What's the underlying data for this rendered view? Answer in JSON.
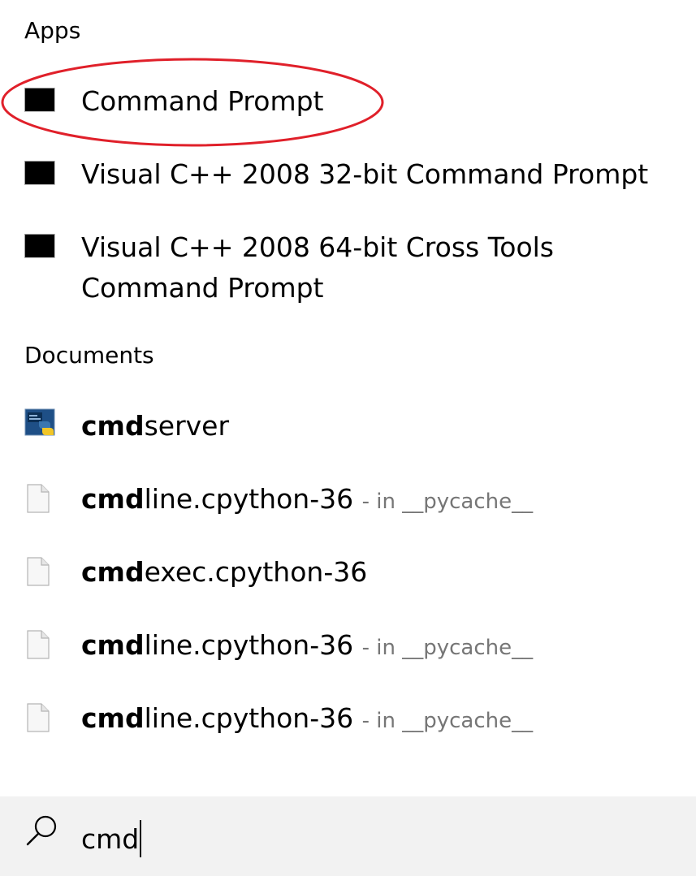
{
  "sections": {
    "apps_header": "Apps",
    "documents_header": "Documents"
  },
  "apps": [
    {
      "label": "Command Prompt",
      "icon": "command-prompt-icon"
    },
    {
      "label": "Visual C++ 2008 32-bit Command Prompt",
      "icon": "command-prompt-icon"
    },
    {
      "label_line1": "Visual C++ 2008 64-bit Cross Tools",
      "label_line2": "Command Prompt",
      "icon": "command-prompt-icon"
    }
  ],
  "documents": [
    {
      "match": "cmd",
      "rest": "server",
      "location": "",
      "icon": "python-file-icon"
    },
    {
      "match": "cmd",
      "rest": "line.cpython-36",
      "location": "- in __pycache__",
      "icon": "document-icon"
    },
    {
      "match": "cmd",
      "rest": "exec.cpython-36",
      "location": "",
      "icon": "document-icon"
    },
    {
      "match": "cmd",
      "rest": "line.cpython-36",
      "location": "- in __pycache__",
      "icon": "document-icon"
    },
    {
      "match": "cmd",
      "rest": "line.cpython-36",
      "location": "- in __pycache__",
      "icon": "document-icon"
    }
  ],
  "search": {
    "value": "cmd",
    "icon": "search-icon"
  },
  "colors": {
    "highlight": "#e0202a",
    "search_bg": "#f2f2f2",
    "location_text": "#767676"
  }
}
